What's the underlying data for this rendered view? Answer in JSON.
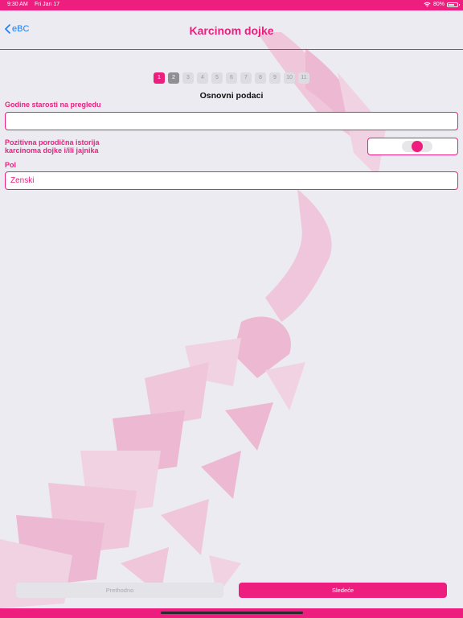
{
  "status_bar": {
    "time": "9:30 AM",
    "date": "Fri Jan 17",
    "battery": "80%",
    "icons": [
      "wifi-icon",
      "battery-icon"
    ]
  },
  "nav": {
    "back_label": "eBC",
    "title": "Karcinom dojke"
  },
  "steps": {
    "labels": [
      "1",
      "2",
      "3",
      "4",
      "5",
      "6",
      "7",
      "8",
      "9",
      "10",
      "11"
    ],
    "active": 1,
    "visited": [
      2
    ]
  },
  "section_title": "Osnovni podaci",
  "form": {
    "age_label": "Godine starosti na pregledu",
    "age_value": "",
    "family_history_label_line1": "Pozitivna porodična istorija",
    "family_history_label_line2": "karcinoma dojke i/ili jajnika",
    "family_history_value": false,
    "sex_label": "Pol",
    "sex_value": "Ženski"
  },
  "buttons": {
    "previous": "Prethodno",
    "next": "Sledeće"
  },
  "colors": {
    "accent": "#ee1e7f",
    "background": "#ebebf1",
    "link": "#1a7df5"
  }
}
